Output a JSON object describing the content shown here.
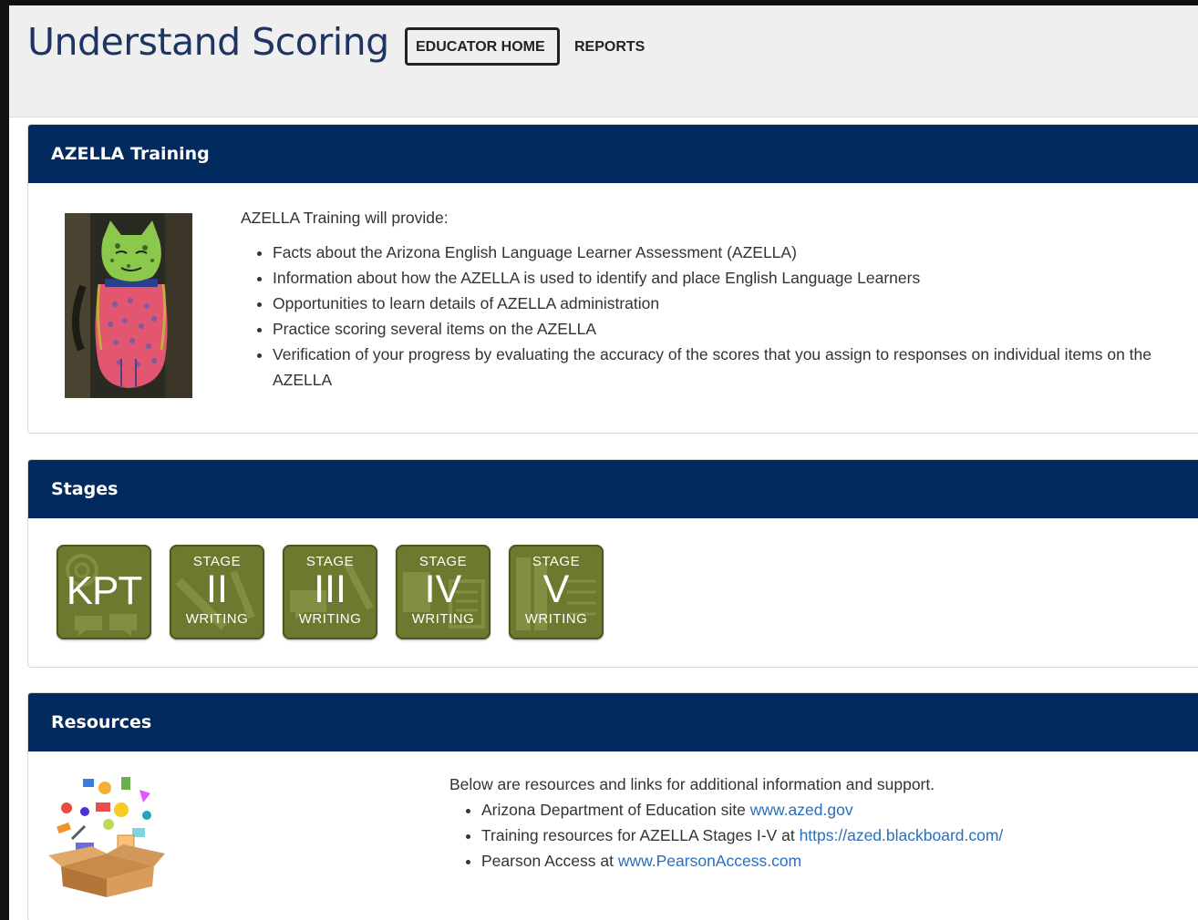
{
  "header": {
    "title": "Understand Scoring",
    "nav": {
      "educator_home": "EDUCATOR HOME",
      "reports": "REPORTS"
    }
  },
  "training": {
    "heading": "AZELLA Training",
    "intro": "AZELLA Training will provide:",
    "items": [
      "Facts about the Arizona English Language Learner Assessment (AZELLA)",
      "Information about how the AZELLA is used to identify and place English Language Learners",
      "Opportunities to learn details of AZELLA administration",
      "Practice scoring several items on the AZELLA",
      "Verification of your progress by evaluating the accuracy of the scores that you assign to responses on individual items on the AZELLA"
    ]
  },
  "stages": {
    "heading": "Stages",
    "tiles": [
      {
        "label": "KPT"
      },
      {
        "top": "STAGE",
        "numeral": "II",
        "bottom": "WRITING"
      },
      {
        "top": "STAGE",
        "numeral": "III",
        "bottom": "WRITING"
      },
      {
        "top": "STAGE",
        "numeral": "IV",
        "bottom": "WRITING"
      },
      {
        "top": "STAGE",
        "numeral": "V",
        "bottom": "WRITING"
      }
    ]
  },
  "resources": {
    "heading": "Resources",
    "intro": "Below are resources and links for additional information and support.",
    "items": [
      {
        "text": "Arizona Department of Education site ",
        "link": "www.azed.gov"
      },
      {
        "text": "Training resources for AZELLA Stages I-V at ",
        "link": "https://azed.blackboard.com/"
      },
      {
        "text": "Pearson Access at ",
        "link": "www.PearsonAccess.com"
      }
    ]
  },
  "colors": {
    "panel_header": "#032a5e",
    "title": "#1e3463",
    "tile": "#6b7a2e",
    "link": "#2a6ebb"
  }
}
